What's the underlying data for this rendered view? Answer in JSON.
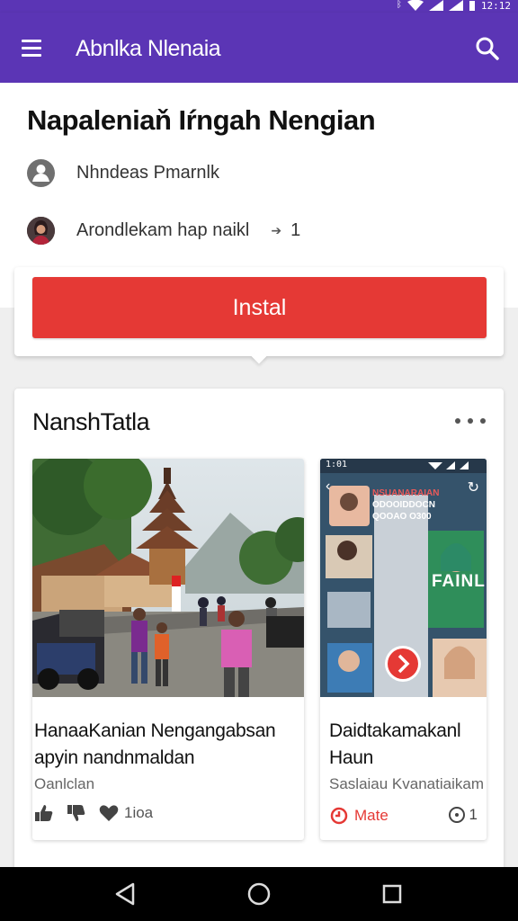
{
  "status_bar": {
    "time": "12:12"
  },
  "app_bar": {
    "title": "Abnlka Nlenaia"
  },
  "detail": {
    "title": "Napaleniaň Iŕngah Nengian",
    "developer": "Nhndeas Pmarnlk",
    "reviewer_text": "Arondlekam hap naikl",
    "reviewer_count": "1"
  },
  "install": {
    "label": "Instal"
  },
  "section": {
    "title": "NanshTatla",
    "items": [
      {
        "title_line1": "HanaaKanian Nengangabsan",
        "title_line2": "apyin nandnmaldan",
        "subtitle": "Oanlclan",
        "like_count": "1ioa"
      },
      {
        "title_line1": "Daidtakamakanl",
        "title_line2": "Haun",
        "subtitle": "Saslaiau Kvanatiaikam",
        "action_label": "Mate",
        "stat": "1"
      }
    ]
  },
  "preview_screen": {
    "status_time": "1:01",
    "header_line1": "NSUANARAIAN",
    "header_line2": "ODOOIDDOCN",
    "header_line3": "QOOAO O300",
    "big_label": "FAINLI"
  },
  "colors": {
    "app_bar": "#5b35b5",
    "install_button": "#e53935",
    "navigation_bar": "#000000"
  }
}
